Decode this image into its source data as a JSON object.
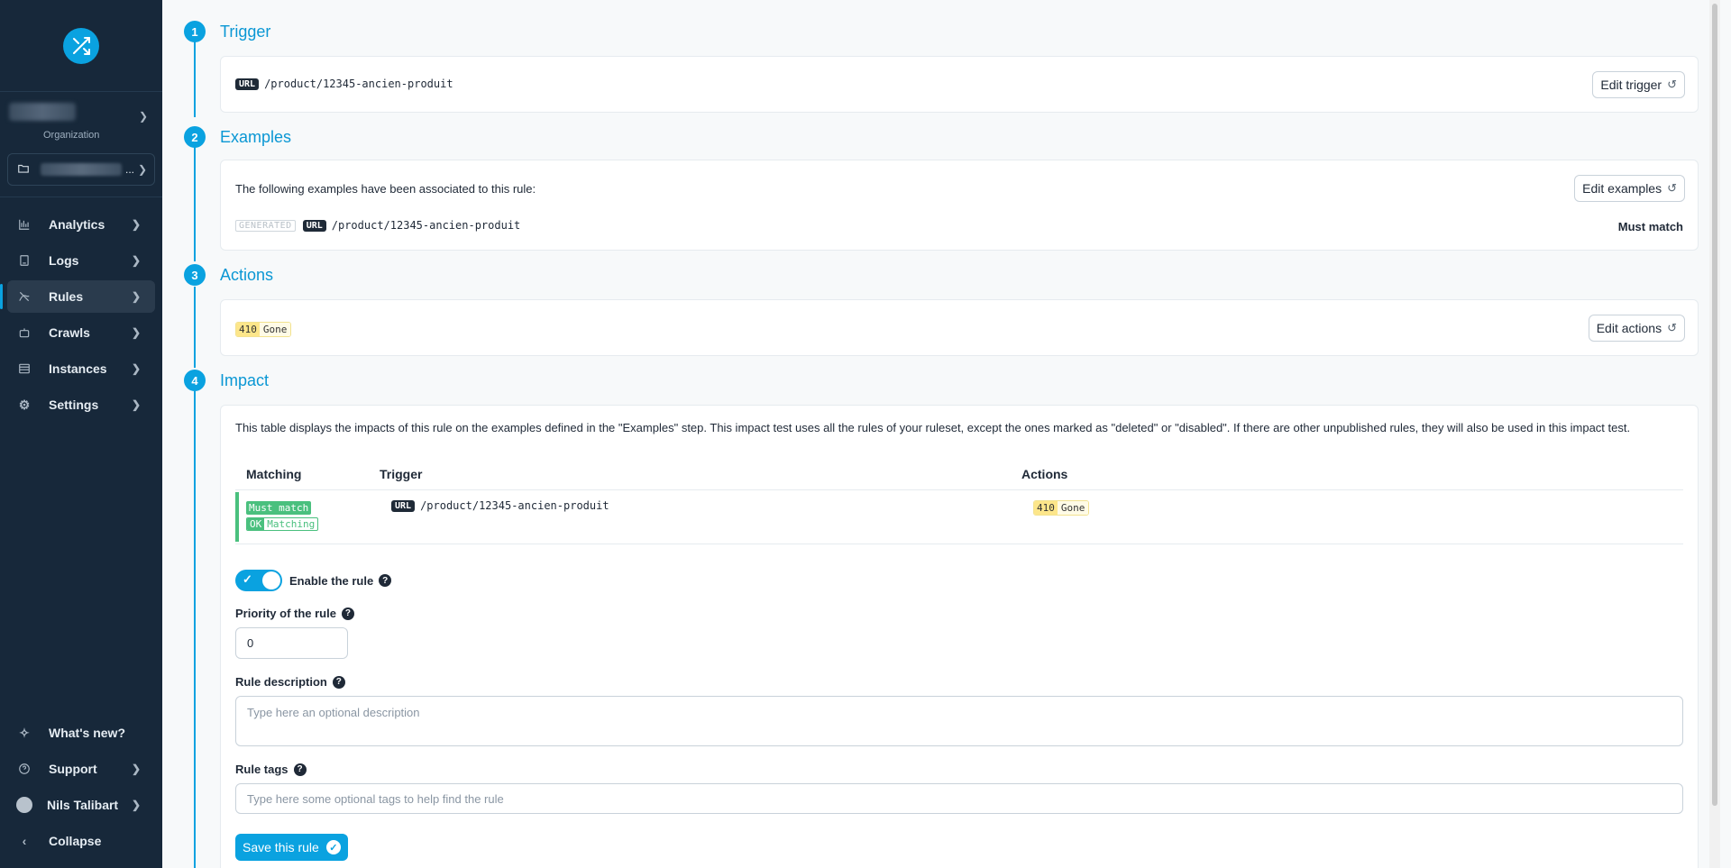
{
  "sidebar": {
    "organization_label": "Organization",
    "project_ellipsis": "...",
    "nav": [
      {
        "label": "Analytics",
        "icon": "chart-bars-icon"
      },
      {
        "label": "Logs",
        "icon": "document-icon"
      },
      {
        "label": "Rules",
        "icon": "rules-icon",
        "active": true
      },
      {
        "label": "Crawls",
        "icon": "robot-icon"
      },
      {
        "label": "Instances",
        "icon": "server-icon"
      },
      {
        "label": "Settings",
        "icon": "gear-icon"
      }
    ],
    "bottom": [
      {
        "label": "What's new?",
        "icon": "sparkles-icon"
      },
      {
        "label": "Support",
        "icon": "question-circle-icon"
      },
      {
        "label": "Nils Talibart",
        "icon": "avatar"
      },
      {
        "label": "Collapse",
        "icon": "chevron-left-icon"
      }
    ]
  },
  "steps": [
    {
      "num": "1",
      "title": "Trigger"
    },
    {
      "num": "2",
      "title": "Examples"
    },
    {
      "num": "3",
      "title": "Actions"
    },
    {
      "num": "4",
      "title": "Impact"
    }
  ],
  "trigger": {
    "url_tag": "URL",
    "path": "/product/12345-ancien-produit",
    "edit_label": "Edit trigger"
  },
  "examples": {
    "intro": "The following examples have been associated to this rule:",
    "edit_label": "Edit examples",
    "generated_tag": "GENERATED",
    "url_tag": "URL",
    "path": "/product/12345-ancien-produit",
    "match_label": "Must match"
  },
  "actions": {
    "code": "410",
    "status": "Gone",
    "edit_label": "Edit actions"
  },
  "impact": {
    "description": "This table displays the impacts of this rule on the examples defined in the \"Examples\" step. This impact test uses all the rules of your ruleset, except the ones marked as \"deleted\" or \"disabled\". If there are other unpublished rules, they will also be used in this impact test.",
    "columns": [
      "Matching",
      "Trigger",
      "Actions"
    ],
    "row": {
      "must_match": "Must match",
      "ok": "OK",
      "matching": "Matching",
      "url_tag": "URL",
      "path": "/product/12345-ancien-produit",
      "code": "410",
      "status": "Gone"
    }
  },
  "form": {
    "enable_label": "Enable the rule",
    "enabled": true,
    "priority_label": "Priority of the rule",
    "priority_value": "0",
    "description_label": "Rule description",
    "description_placeholder": "Type here an optional description",
    "tags_label": "Rule tags",
    "tags_placeholder": "Type here some optional tags to help find the rule",
    "save_label": "Save this rule"
  },
  "colors": {
    "accent": "#0aa2e0",
    "sidebar": "#17283a",
    "success": "#4ac07e",
    "warning": "#fde68a"
  }
}
